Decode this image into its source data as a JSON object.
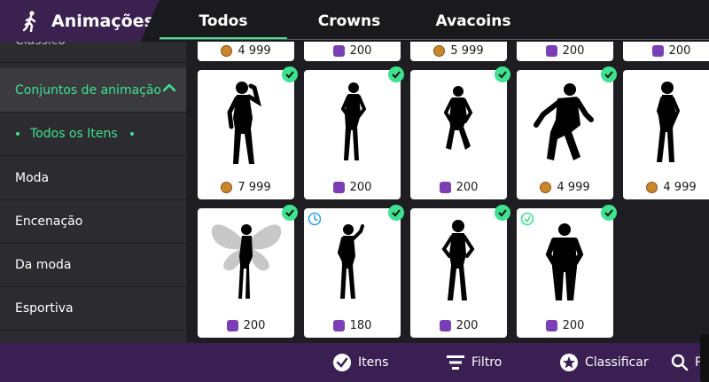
{
  "header": {
    "title": "Animações",
    "tabs": [
      {
        "label": "Todos",
        "active": true
      },
      {
        "label": "Crowns",
        "active": false
      },
      {
        "label": "Avacoins",
        "active": false
      }
    ],
    "accent": "#3ee28f"
  },
  "sidebar": {
    "cut_item": "Clássico",
    "group": "Conjuntos de animação",
    "sub_item": "Todos os Itens",
    "items": [
      "Moda",
      "Encenação",
      "Da moda",
      "Esportiva"
    ]
  },
  "grid": {
    "top_row_prices": [
      "4 999",
      "200",
      "5 999",
      "200",
      "200"
    ],
    "top_row_currency": [
      "gold",
      "crown",
      "gold",
      "crown",
      "crown"
    ],
    "row1": [
      {
        "price": "7 999",
        "currency": "gold",
        "owned": true
      },
      {
        "price": "200",
        "currency": "crown",
        "owned": true
      },
      {
        "price": "200",
        "currency": "crown",
        "owned": true
      },
      {
        "price": "4 999",
        "currency": "gold",
        "owned": true
      },
      {
        "price": "4 999",
        "currency": "gold",
        "owned": false
      }
    ],
    "row2": [
      {
        "price": "200",
        "currency": "crown",
        "owned": true,
        "badge": ""
      },
      {
        "price": "180",
        "currency": "crown",
        "owned": true,
        "badge": "clock-icon"
      },
      {
        "price": "200",
        "currency": "crown",
        "owned": true,
        "badge": ""
      },
      {
        "price": "200",
        "currency": "crown",
        "owned": true,
        "badge": "tag-icon"
      }
    ]
  },
  "bottombar": {
    "items_label": "Itens",
    "filter_label": "Filtro",
    "sort_label": "Classificar",
    "search_label": "Pe"
  }
}
